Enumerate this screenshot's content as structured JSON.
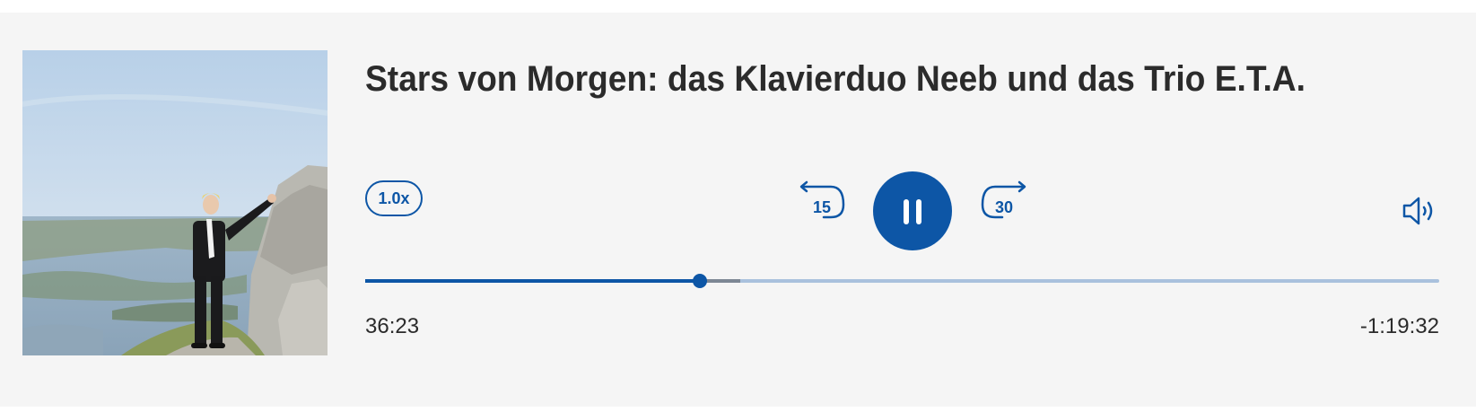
{
  "episode": {
    "title": "Stars von Morgen: das Klavierduo Neeb und das Trio E.T.A."
  },
  "controls": {
    "playback_rate": "1.0x",
    "skip_back_seconds": "15",
    "skip_forward_seconds": "30",
    "state": "playing"
  },
  "progress": {
    "played_fraction": 0.3118,
    "buffered_fraction": 0.349,
    "elapsed": "36:23",
    "remaining": "-1:19:32"
  },
  "colors": {
    "accent": "#0d56a6",
    "title_text": "#2b2b2b",
    "background": "#f5f5f5",
    "rail": "#a9c1dd",
    "buffered": "#7d8794"
  },
  "icons": {
    "play_button": "pause-icon",
    "skip_back": "rewind-15-icon",
    "skip_forward": "forward-30-icon",
    "volume": "speaker-icon"
  }
}
